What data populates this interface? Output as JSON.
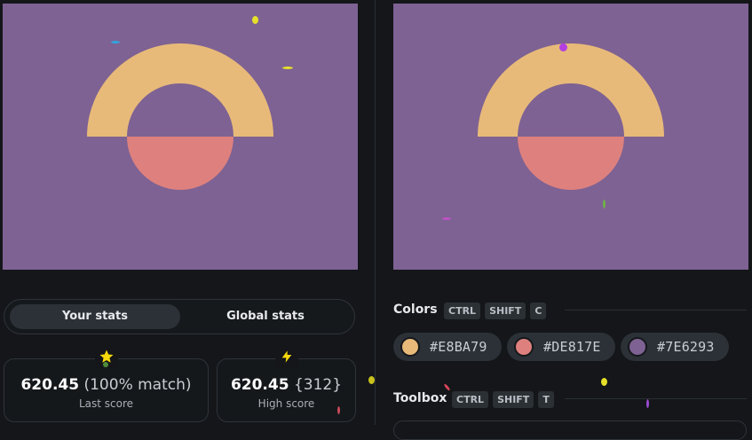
{
  "canvas_background": "#7E6293",
  "shapes": {
    "arch_color": "#E8BA79",
    "half_circle_color": "#DE817E"
  },
  "stats_tabs": {
    "your_stats": "Your stats",
    "global_stats": "Global stats"
  },
  "last_score": {
    "icon": "star-icon",
    "value": "620.45",
    "detail": "(100% match)",
    "label": "Last score"
  },
  "high_score": {
    "icon": "lightning-icon",
    "value": "620.45",
    "detail": "{312}",
    "label": "High score"
  },
  "colors_section": {
    "title": "Colors",
    "shortcut": [
      "CTRL",
      "SHIFT",
      "C"
    ],
    "swatches": [
      {
        "hex": "#E8BA79",
        "color": "#E8BA79"
      },
      {
        "hex": "#DE817E",
        "color": "#DE817E"
      },
      {
        "hex": "#7E6293",
        "color": "#7E6293"
      }
    ]
  },
  "toolbox_section": {
    "title": "Toolbox",
    "shortcut": [
      "CTRL",
      "SHIFT",
      "T"
    ]
  }
}
